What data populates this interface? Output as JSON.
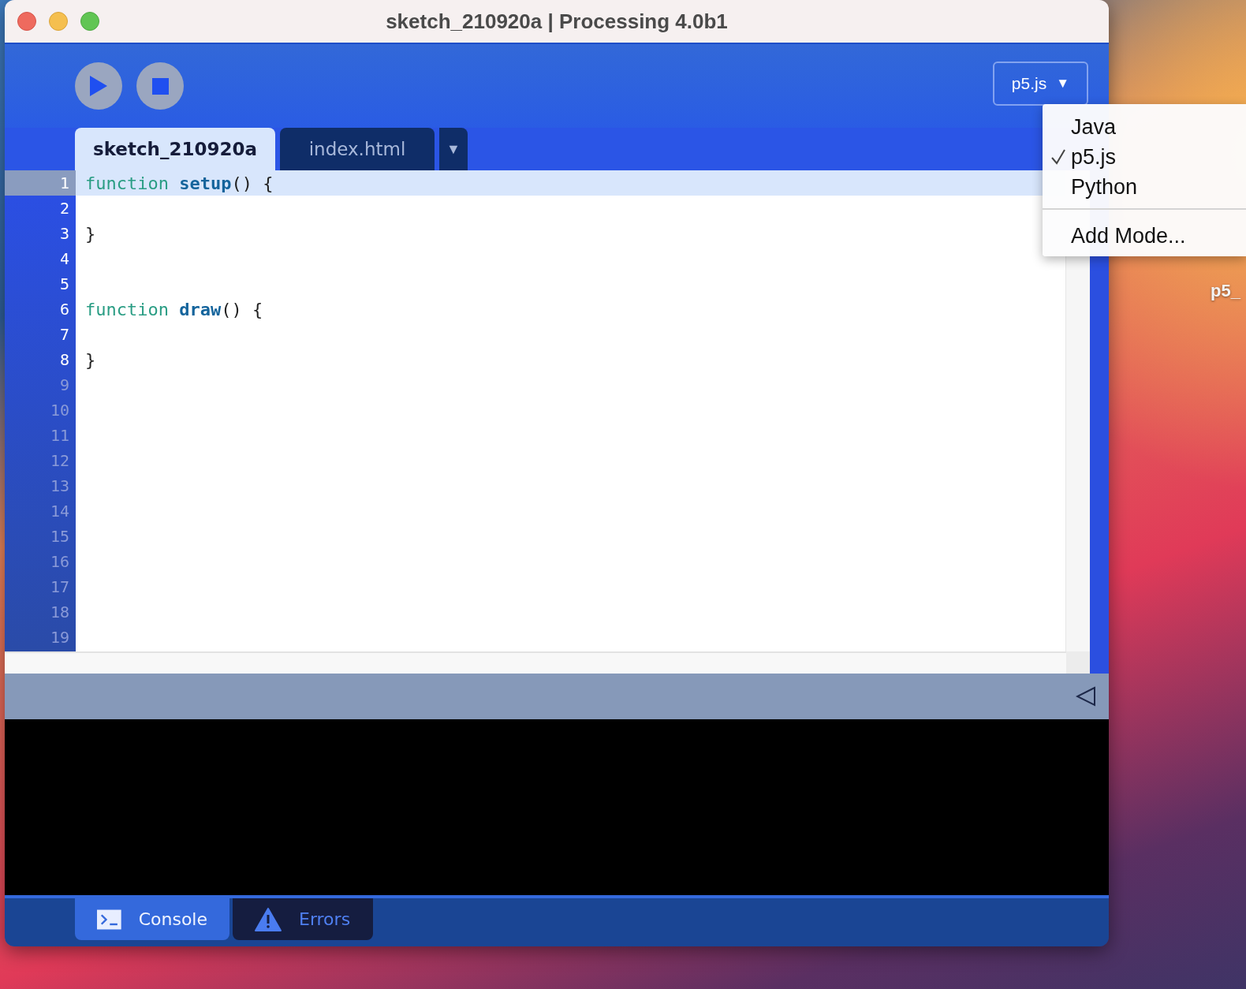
{
  "window": {
    "title": "sketch_210920a | Processing 4.0b1"
  },
  "toolbar": {
    "buttons": [
      {
        "kind": "run"
      },
      {
        "kind": "stop"
      }
    ],
    "mode_button": {
      "label": "p5.js",
      "arrow": "▼"
    }
  },
  "mode_menu": {
    "items": [
      {
        "label": "Java",
        "checked": false
      },
      {
        "label": "p5.js",
        "checked": true
      },
      {
        "label": "Python",
        "checked": false
      }
    ],
    "extra": "Add Mode..."
  },
  "tabs": [
    {
      "label": "sketch_210920a",
      "selected": true
    },
    {
      "label": "index.html",
      "selected": false
    }
  ],
  "tab_menu": "▼",
  "editor": {
    "lines": [
      {
        "number": "1",
        "current": true,
        "past_end": false,
        "tokens": [
          {
            "kind": "keyword",
            "text": "function"
          },
          {
            "kind": "name",
            "text": "setup"
          },
          {
            "kind": "plain",
            "text": "() {"
          }
        ]
      },
      {
        "number": "2",
        "current": false,
        "past_end": false
      },
      {
        "number": "3",
        "current": false,
        "past_end": false,
        "tokens": [
          {
            "kind": "plain",
            "text": "}"
          }
        ]
      },
      {
        "number": "4",
        "current": false,
        "past_end": false
      },
      {
        "number": "5",
        "current": false,
        "past_end": false
      },
      {
        "number": "6",
        "current": false,
        "past_end": false,
        "tokens": [
          {
            "kind": "keyword",
            "text": "function"
          },
          {
            "kind": "name",
            "text": "draw"
          },
          {
            "kind": "plain",
            "text": "() {"
          }
        ]
      },
      {
        "number": "7",
        "current": false,
        "past_end": false
      },
      {
        "number": "8",
        "current": false,
        "past_end": false,
        "tokens": [
          {
            "kind": "plain",
            "text": "}"
          }
        ]
      },
      {
        "number": "9",
        "current": false,
        "past_end": true
      },
      {
        "number": "10",
        "current": false,
        "past_end": true
      },
      {
        "number": "11",
        "current": false,
        "past_end": true
      },
      {
        "number": "12",
        "current": false,
        "past_end": true
      },
      {
        "number": "13",
        "current": false,
        "past_end": true
      },
      {
        "number": "14",
        "current": false,
        "past_end": true
      },
      {
        "number": "15",
        "current": false,
        "past_end": true
      },
      {
        "number": "16",
        "current": false,
        "past_end": true
      },
      {
        "number": "17",
        "current": false,
        "past_end": true
      },
      {
        "number": "18",
        "current": false,
        "past_end": true
      },
      {
        "number": "19",
        "current": false,
        "past_end": true
      }
    ]
  },
  "console_tabs": [
    {
      "kind": "console",
      "label": "Console",
      "selected": true
    },
    {
      "kind": "errors",
      "label": "Errors",
      "selected": false
    }
  ],
  "desktop": {
    "icon_label": "p5_"
  }
}
